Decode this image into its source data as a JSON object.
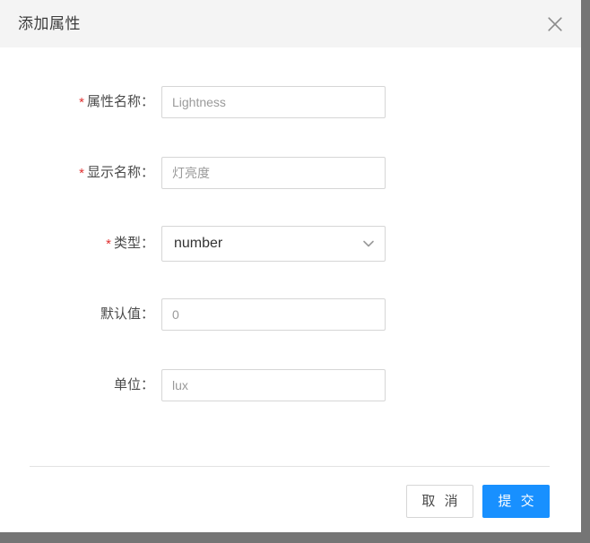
{
  "overlay": {
    "color": "#757575"
  },
  "modal": {
    "title": "添加属性",
    "close_icon": "close-icon",
    "accent_color": "#1890ff",
    "required_marker": "*",
    "header_bg": "#f4f4f4"
  },
  "form": {
    "fields": [
      {
        "label": "属性名称：",
        "required": true,
        "control": "text",
        "value": "",
        "placeholder": "Lightness"
      },
      {
        "label": "显示名称：",
        "required": true,
        "control": "text",
        "value": "",
        "placeholder": "灯亮度"
      },
      {
        "label": "类型：",
        "required": true,
        "control": "select",
        "value": "number",
        "arrow_icon": "chevron-down-icon"
      },
      {
        "label": "默认值：",
        "required": false,
        "control": "text",
        "value": "",
        "placeholder": "0"
      },
      {
        "label": "单位：",
        "required": false,
        "control": "text",
        "value": "",
        "placeholder": "lux"
      }
    ]
  },
  "footer": {
    "cancel_label": "取 消",
    "submit_label": "提 交"
  }
}
